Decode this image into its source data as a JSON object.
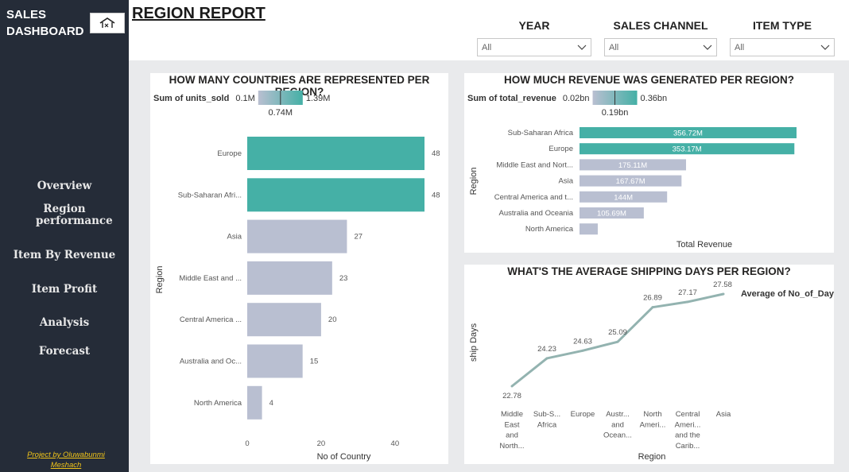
{
  "sidebar": {
    "brand_line1": "SALES",
    "brand_line2": "DASHBOARD",
    "home_icon": "home-icon",
    "nav": [
      "Overview",
      "Region performance",
      "Item By Revenue",
      "Item Profit",
      "Analysis",
      "Forecast"
    ],
    "credit_line1": "Project by Oluwabunmi",
    "credit_line2": "Meshach",
    "bg_color": "#252c38",
    "credit_color": "#f0c419"
  },
  "header": {
    "title": "REGION REPORT",
    "slicers": [
      {
        "label": "YEAR",
        "value": "All"
      },
      {
        "label": "SALES CHANNEL",
        "value": "All"
      },
      {
        "label": "ITEM TYPE",
        "value": "All"
      }
    ]
  },
  "colors": {
    "accent": "#45b0a6",
    "bar_default": "#b9bfd1",
    "line": "#93b3b0"
  },
  "chart_data": [
    {
      "type": "bar",
      "orientation": "horizontal",
      "title": "HOW MANY COUNTRIES ARE REPRESENTED PER REGION?",
      "xlabel": "No of Country",
      "ylabel": "Region",
      "categories": [
        "Europe",
        "Sub-Saharan Afri...",
        "Asia",
        "Middle East and ...",
        "Central America ...",
        "Australia and Oc...",
        "North America"
      ],
      "values": [
        48,
        48,
        27,
        23,
        20,
        15,
        4
      ],
      "data_labels": [
        "48",
        "48",
        "27",
        "23",
        "20",
        "15",
        "4"
      ],
      "highlighted": [
        0,
        1
      ],
      "xticks": [
        "0",
        "20",
        "40"
      ],
      "xlim": [
        0,
        48
      ],
      "legend": {
        "field": "Sum of units_sold",
        "min": "0.1M",
        "max": "1.39M",
        "mid": "0.74M"
      }
    },
    {
      "type": "bar",
      "orientation": "horizontal",
      "title": "HOW MUCH REVENUE WAS GENERATED PER REGION?",
      "xlabel": "Total Revenue",
      "ylabel": "Region",
      "categories": [
        "Sub-Saharan Africa",
        "Europe",
        "Middle East and Nort...",
        "Asia",
        "Central America and t...",
        "Australia and Oceania",
        "North America"
      ],
      "values": [
        356.72,
        353.17,
        175.11,
        167.67,
        144,
        105.69,
        30
      ],
      "data_labels": [
        "356.72M",
        "353.17M",
        "175.11M",
        "167.67M",
        "144M",
        "105.69M",
        ""
      ],
      "highlighted": [
        0,
        1
      ],
      "xlim": [
        0,
        356.72
      ],
      "legend": {
        "field": "Sum of total_revenue",
        "min": "0.02bn",
        "max": "0.36bn",
        "mid": "0.19bn"
      }
    },
    {
      "type": "line",
      "title": "WHAT'S THE AVERAGE SHIPPING DAYS PER REGION?",
      "xlabel": "Region",
      "ylabel": "ship Days",
      "series": [
        {
          "name": "Average of No_of_Days",
          "values": [
            22.78,
            24.23,
            24.63,
            25.09,
            26.89,
            27.17,
            27.58
          ]
        }
      ],
      "data_labels": [
        "22.78",
        "24.23",
        "24.63",
        "25.09",
        "26.89",
        "27.17",
        "27.58"
      ],
      "categories": [
        [
          "Middle",
          "East",
          "and",
          "North..."
        ],
        [
          "Sub-S...",
          "Africa"
        ],
        [
          "Europe"
        ],
        [
          "Austr...",
          "and",
          "Ocean..."
        ],
        [
          "North",
          "Ameri..."
        ],
        [
          "Central",
          "Ameri...",
          "and the",
          "Carib..."
        ],
        [
          "Asia"
        ]
      ],
      "ylim": [
        22.78,
        27.58
      ]
    }
  ]
}
